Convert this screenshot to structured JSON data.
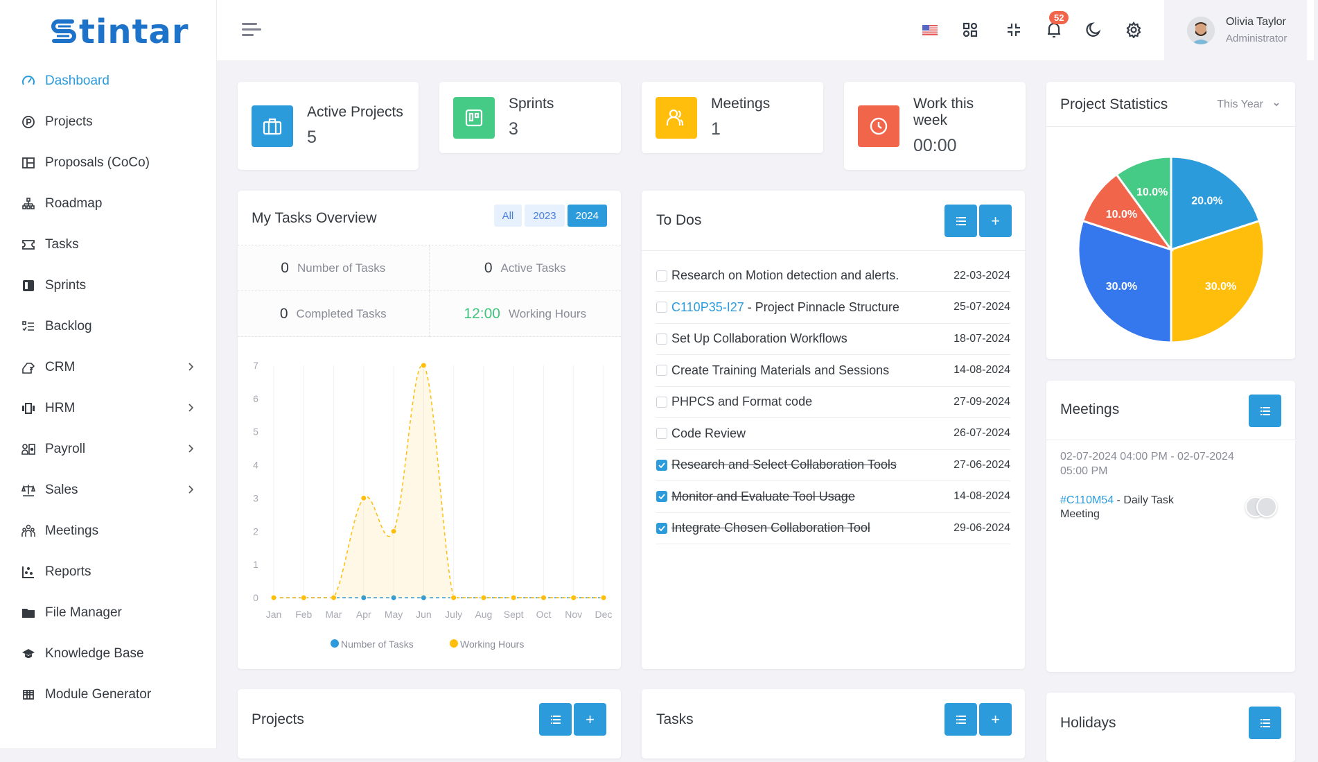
{
  "brand": {
    "name": "tintar",
    "logo_letter": "S",
    "color": "#1d73c9"
  },
  "sidebar": {
    "items": [
      {
        "label": "Dashboard",
        "icon": "gauge-icon",
        "active": true,
        "has_children": false
      },
      {
        "label": "Projects",
        "icon": "circle-p-icon",
        "has_children": false
      },
      {
        "label": "Proposals (CoCo)",
        "icon": "layout-icon",
        "has_children": false
      },
      {
        "label": "Roadmap",
        "icon": "hierarchy-icon",
        "has_children": false
      },
      {
        "label": "Tasks",
        "icon": "ticket-icon",
        "has_children": false
      },
      {
        "label": "Sprints",
        "icon": "board-icon",
        "has_children": false
      },
      {
        "label": "Backlog",
        "icon": "checklist-icon",
        "has_children": false
      },
      {
        "label": "CRM",
        "icon": "handshake-icon",
        "has_children": true
      },
      {
        "label": "HRM",
        "icon": "carousel-icon",
        "has_children": true
      },
      {
        "label": "Payroll",
        "icon": "user-money-icon",
        "has_children": true
      },
      {
        "label": "Sales",
        "icon": "scale-icon",
        "has_children": true
      },
      {
        "label": "Meetings",
        "icon": "users-group-icon",
        "has_children": false
      },
      {
        "label": "Reports",
        "icon": "scatter-chart-icon",
        "has_children": false
      },
      {
        "label": "File Manager",
        "icon": "folder-icon",
        "has_children": false
      },
      {
        "label": "Knowledge Base",
        "icon": "graduation-cap-icon",
        "has_children": false
      },
      {
        "label": "Module Generator",
        "icon": "table-grid-icon",
        "has_children": false
      }
    ]
  },
  "header": {
    "notifications_count": "52",
    "language": "en-US",
    "user": {
      "name": "Olivia Taylor",
      "role": "Administrator"
    }
  },
  "stats": [
    {
      "title": "Active Projects",
      "value": "5",
      "color": "#2b9bdb",
      "icon": "briefcase-icon"
    },
    {
      "title": "Sprints",
      "value": "3",
      "color": "#45cb85",
      "icon": "trello-icon"
    },
    {
      "title": "Meetings",
      "value": "1",
      "color": "#ffbe0b",
      "icon": "users-icon"
    },
    {
      "title": "Work this week",
      "value": "00:00",
      "color": "#f1654a",
      "icon": "clock-icon"
    }
  ],
  "tasks_overview": {
    "title": "My Tasks Overview",
    "year_filters": [
      {
        "label": "All",
        "active": false
      },
      {
        "label": "2023",
        "active": false
      },
      {
        "label": "2024",
        "active": true
      }
    ],
    "stats": [
      {
        "value": "0",
        "label": "Number of Tasks"
      },
      {
        "value": "0",
        "label": "Active Tasks"
      },
      {
        "value": "0",
        "label": "Completed Tasks"
      },
      {
        "value": "12:00",
        "label": "Working Hours"
      }
    ]
  },
  "chart_data": [
    {
      "type": "area",
      "title": "My Tasks Overview",
      "categories": [
        "Jan",
        "Feb",
        "Mar",
        "Apr",
        "May",
        "Jun",
        "July",
        "Aug",
        "Sept",
        "Oct",
        "Nov",
        "Dec"
      ],
      "series": [
        {
          "name": "Number of Tasks",
          "color": "#2b9bdb",
          "values": [
            0,
            0,
            0,
            0,
            0,
            0,
            0,
            0,
            0,
            0,
            0,
            0
          ]
        },
        {
          "name": "Working Hours",
          "color": "#ffbe0b",
          "values": [
            0,
            0,
            0,
            3,
            2,
            7,
            0,
            0,
            0,
            0,
            0,
            0
          ]
        }
      ],
      "ylim": [
        0,
        7
      ],
      "yticks": [
        0,
        1,
        2,
        3,
        4,
        5,
        6,
        7
      ],
      "grid": true,
      "legend": "bottom-center"
    },
    {
      "type": "pie",
      "title": "Project Statistics",
      "slices": [
        {
          "label": "20.0%",
          "value": 20,
          "color": "#2b9bdb"
        },
        {
          "label": "30.0%",
          "value": 30,
          "color": "#ffbe0b"
        },
        {
          "label": "30.0%",
          "value": 30,
          "color": "#3577ec"
        },
        {
          "label": "10.0%",
          "value": 10,
          "color": "#f1654a"
        },
        {
          "label": "10.0%",
          "value": 10,
          "color": "#45cb85"
        }
      ]
    }
  ],
  "project_stats": {
    "title": "Project Statistics",
    "period": "This Year"
  },
  "todos": {
    "title": "To Dos",
    "items": [
      {
        "code": "",
        "text": "Research on Motion detection and alerts.",
        "date": "22-03-2024",
        "done": false
      },
      {
        "code": "C110P35-I27",
        "text": " - Project Pinnacle Structure",
        "date": "25-07-2024",
        "done": false
      },
      {
        "code": "",
        "text": "Set Up Collaboration Workflows",
        "date": "18-07-2024",
        "done": false
      },
      {
        "code": "",
        "text": "Create Training Materials and Sessions",
        "date": "14-08-2024",
        "done": false
      },
      {
        "code": "",
        "text": "PHPCS and Format code",
        "date": "27-09-2024",
        "done": false
      },
      {
        "code": "",
        "text": "Code Review",
        "date": "26-07-2024",
        "done": false
      },
      {
        "code": "",
        "text": "Research and Select Collaboration Tools",
        "date": "27-06-2024",
        "done": true
      },
      {
        "code": "",
        "text": "Monitor and Evaluate Tool Usage",
        "date": "14-08-2024",
        "done": true
      },
      {
        "code": "",
        "text": "Integrate Chosen Collaboration Tool",
        "date": "29-06-2024",
        "done": true
      }
    ]
  },
  "meetings": {
    "title": "Meetings",
    "items": [
      {
        "time": "02-07-2024 04:00 PM - 02-07-2024 05:00 PM",
        "code": "#C110M54",
        "title": " - Daily Task Meeting",
        "attendees": 2
      }
    ]
  },
  "bottom": {
    "projects_title": "Projects",
    "tasks_title": "Tasks",
    "holidays_title": "Holidays"
  }
}
